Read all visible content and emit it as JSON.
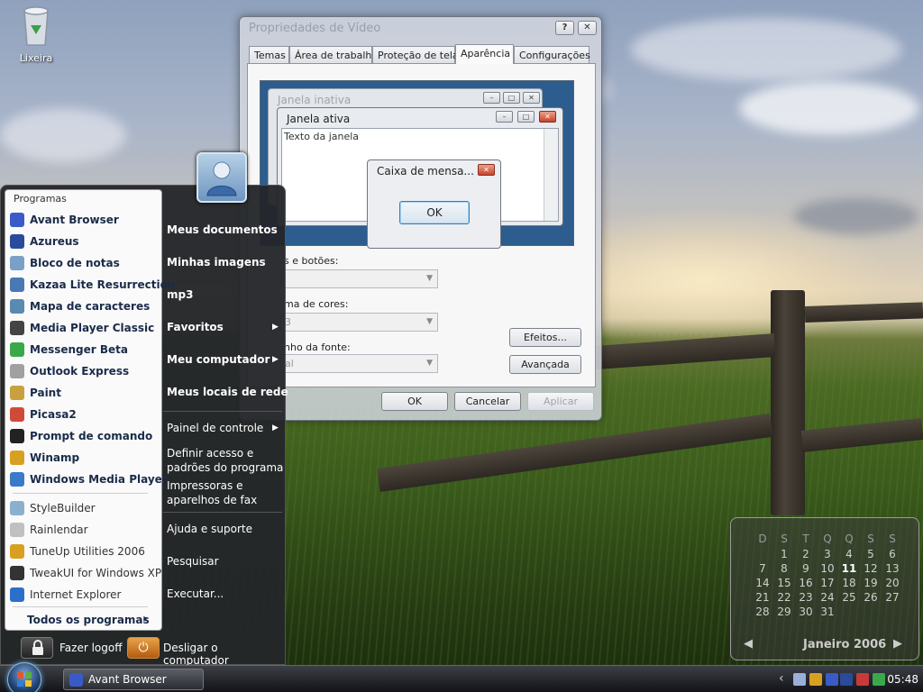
{
  "desktop": {
    "icon_label": "Lixeira"
  },
  "dialog": {
    "title": "Propriedades de Vídeo",
    "help_btn": "?",
    "close_btn": "✕",
    "tabs": [
      "Temas",
      "Área de trabalho",
      "Proteção de tela",
      "Aparência",
      "Configurações"
    ],
    "active_tab": "Aparência",
    "preview": {
      "inactive_title": "Janela inativa",
      "active_title": "Janela ativa",
      "window_text": "Texto da janela",
      "message_title": "Caixa de mensa...",
      "ok_label": "OK"
    },
    "field1_label": "s e botões:",
    "field2_label": "ma de cores:",
    "field2_value": "3",
    "field3_label": "nho da fonte:",
    "field3_value": "al",
    "effects_btn": "Efeitos...",
    "advanced_btn": "Avançada",
    "ok_btn": "OK",
    "cancel_btn": "Cancelar",
    "apply_btn": "Aplicar"
  },
  "start_menu": {
    "programs_title": "Programas",
    "pinned": [
      {
        "label": "Avant Browser",
        "color": "#3a5bc7"
      },
      {
        "label": "Azureus",
        "color": "#2a4a9a"
      },
      {
        "label": "Bloco de notas",
        "color": "#7aa0c8"
      },
      {
        "label": "Kazaa Lite Resurrection",
        "color": "#4a78b5"
      },
      {
        "label": "Mapa de caracteres",
        "color": "#5a8ab0"
      },
      {
        "label": "Media Player Classic",
        "color": "#444444"
      },
      {
        "label": "Messenger Beta",
        "color": "#3aa84a"
      },
      {
        "label": "Outlook Express",
        "color": "#a0a0a0"
      },
      {
        "label": "Paint",
        "color": "#c8a040"
      },
      {
        "label": "Picasa2",
        "color": "#d04a3a"
      },
      {
        "label": "Prompt de comando",
        "color": "#222222"
      },
      {
        "label": "Winamp",
        "color": "#d8a020"
      },
      {
        "label": "Windows Media Player",
        "color": "#3a7ac8"
      }
    ],
    "recent": [
      {
        "label": "StyleBuilder",
        "color": "#8ab0d0"
      },
      {
        "label": "Rainlendar",
        "color": "#c0c0c0"
      },
      {
        "label": "TuneUp Utilities 2006",
        "color": "#d8a020"
      },
      {
        "label": "TweakUI for Windows XP",
        "color": "#333333"
      },
      {
        "label": "Internet Explorer",
        "color": "#2a70c8"
      }
    ],
    "all_programs": "Todos os programas",
    "all_programs_arrow": "›",
    "right_items": [
      {
        "label": "Meus documentos",
        "bold": true,
        "arrow": ""
      },
      {
        "label": "Minhas imagens",
        "bold": true,
        "arrow": ""
      },
      {
        "label": "mp3",
        "bold": true,
        "arrow": ""
      },
      {
        "label": "Favoritos",
        "bold": true,
        "arrow": "▶"
      },
      {
        "label": "Meu computador",
        "bold": true,
        "arrow": "▶"
      },
      {
        "label": "Meus locais de rede",
        "bold": true,
        "arrow": ""
      },
      {
        "label": "Painel de controle",
        "bold": false,
        "arrow": "▶"
      },
      {
        "label": "Definir acesso e",
        "bold": false,
        "arrow": ""
      },
      {
        "label": "padrões do programa",
        "bold": false,
        "arrow": ""
      },
      {
        "label": "Impressoras e",
        "bold": false,
        "arrow": ""
      },
      {
        "label": "aparelhos de fax",
        "bold": false,
        "arrow": ""
      },
      {
        "label": "Ajuda e suporte",
        "bold": false,
        "arrow": ""
      },
      {
        "label": "Pesquisar",
        "bold": false,
        "arrow": ""
      },
      {
        "label": "Executar...",
        "bold": false,
        "arrow": ""
      }
    ],
    "logoff_label": "Fazer logoff",
    "shutdown_label": "Desligar o computador"
  },
  "taskbar": {
    "task_label": "Avant Browser",
    "clock": "05:48",
    "tray_icons": [
      {
        "name": "chevron-left-icon",
        "color": "#cccccc"
      },
      {
        "name": "mail-icon",
        "color": "#9ab0d8"
      },
      {
        "name": "winamp-tray-icon",
        "color": "#d8a020"
      },
      {
        "name": "avant-tray-icon",
        "color": "#3a5bc7"
      },
      {
        "name": "azureus-tray-icon",
        "color": "#2a4a9a"
      },
      {
        "name": "antivirus-tray-icon",
        "color": "#c83a3a"
      },
      {
        "name": "messenger-tray-icon",
        "color": "#3aa84a"
      }
    ]
  },
  "calendar": {
    "weekdays": [
      "D",
      "S",
      "T",
      "Q",
      "Q",
      "S",
      "S"
    ],
    "days": [
      "",
      "1",
      "2",
      "3",
      "4",
      "5",
      "6",
      "7",
      "8",
      "9",
      "10",
      "11",
      "12",
      "13",
      "14",
      "15",
      "16",
      "17",
      "18",
      "19",
      "20",
      "21",
      "22",
      "23",
      "24",
      "25",
      "26",
      "27",
      "28",
      "29",
      "30",
      "31"
    ],
    "today": "11",
    "month": "Janeiro",
    "year": "2006",
    "prev": "◀",
    "next": "▶"
  }
}
